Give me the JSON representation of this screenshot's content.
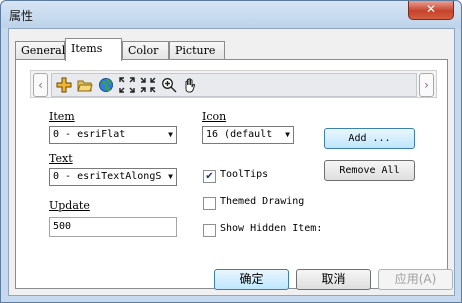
{
  "window": {
    "title": "属性",
    "close_glyph": "✕"
  },
  "tabs": [
    {
      "label": "General"
    },
    {
      "label": "Items"
    },
    {
      "label": "Color"
    },
    {
      "label": "Picture"
    }
  ],
  "toolbar": {
    "left_arrow": "‹",
    "right_arrow": "›",
    "icons": [
      "add-item-icon",
      "open-folder-icon",
      "globe-icon",
      "full-extent-icon",
      "fixed-zoom-out-icon",
      "zoom-in-icon",
      "pan-hand-icon"
    ]
  },
  "form": {
    "item": {
      "label": "Item",
      "value": "0 - esriFlat"
    },
    "icon": {
      "label": "Icon",
      "value": "16  (default"
    },
    "text": {
      "label": "Text",
      "value": "0 - esriTextAlongS"
    },
    "update": {
      "label": "Update",
      "value": "500"
    },
    "tooltips": {
      "label": "ToolTips",
      "checked": true
    },
    "themed": {
      "label": "Themed Drawing",
      "checked": false
    },
    "hidden": {
      "label": "Show Hidden Item:",
      "checked": false
    },
    "add_button": "Add ...",
    "remove_all_button": "Remove  All"
  },
  "footer": {
    "ok": "确定",
    "cancel": "取消",
    "apply": "应用(A)"
  }
}
